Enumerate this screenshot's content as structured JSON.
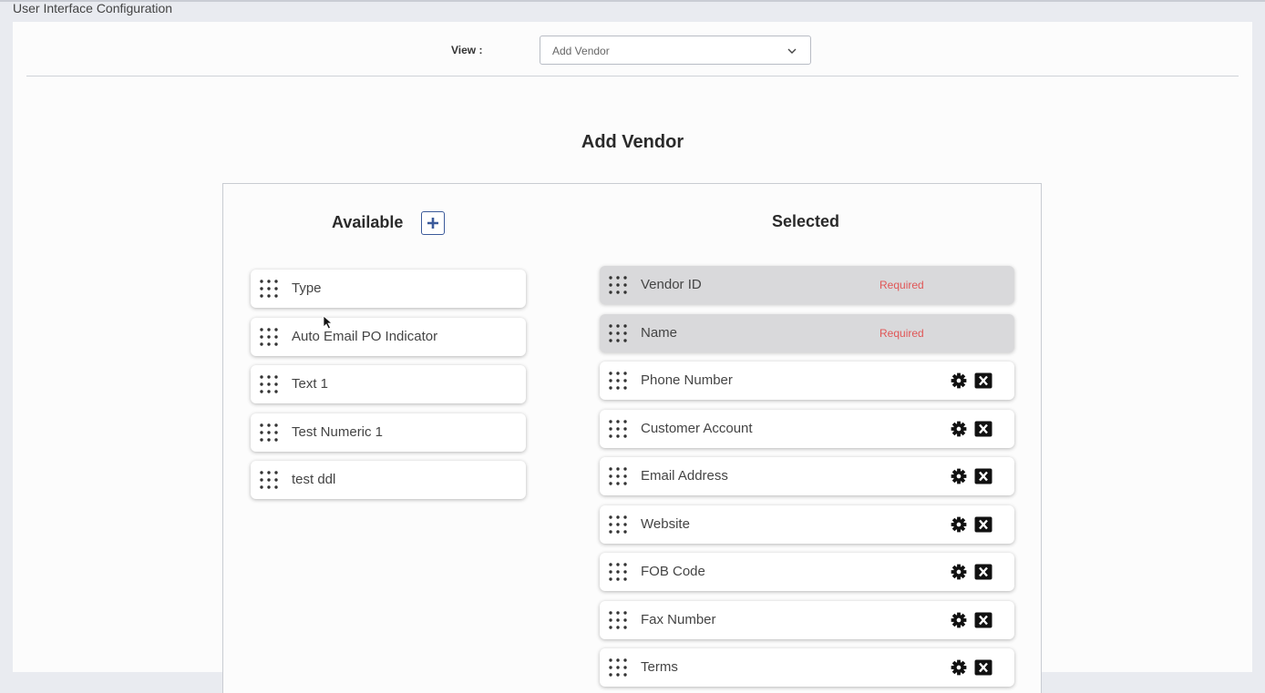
{
  "header": {
    "title": "User Interface Configuration"
  },
  "view": {
    "label": "View :",
    "selected": "Add Vendor"
  },
  "section": {
    "title": "Add Vendor"
  },
  "available": {
    "title": "Available",
    "items": [
      {
        "label": "Type"
      },
      {
        "label": "Auto Email PO Indicator"
      },
      {
        "label": "Text 1"
      },
      {
        "label": "Test Numeric 1"
      },
      {
        "label": "test ddl"
      }
    ]
  },
  "selected": {
    "title": "Selected",
    "required_text": "Required",
    "items": [
      {
        "label": "Vendor ID",
        "required": true
      },
      {
        "label": "Name",
        "required": true
      },
      {
        "label": "Phone Number",
        "required": false
      },
      {
        "label": "Customer Account",
        "required": false
      },
      {
        "label": "Email Address",
        "required": false
      },
      {
        "label": "Website",
        "required": false
      },
      {
        "label": "FOB Code",
        "required": false
      },
      {
        "label": "Fax Number",
        "required": false
      },
      {
        "label": "Terms",
        "required": false
      }
    ]
  },
  "colors": {
    "required": "#e05757",
    "accent": "#3b5a9a"
  },
  "icons": [
    "drag-handle-icon",
    "plus-icon",
    "gear-icon",
    "close-icon",
    "chevron-down-icon"
  ]
}
